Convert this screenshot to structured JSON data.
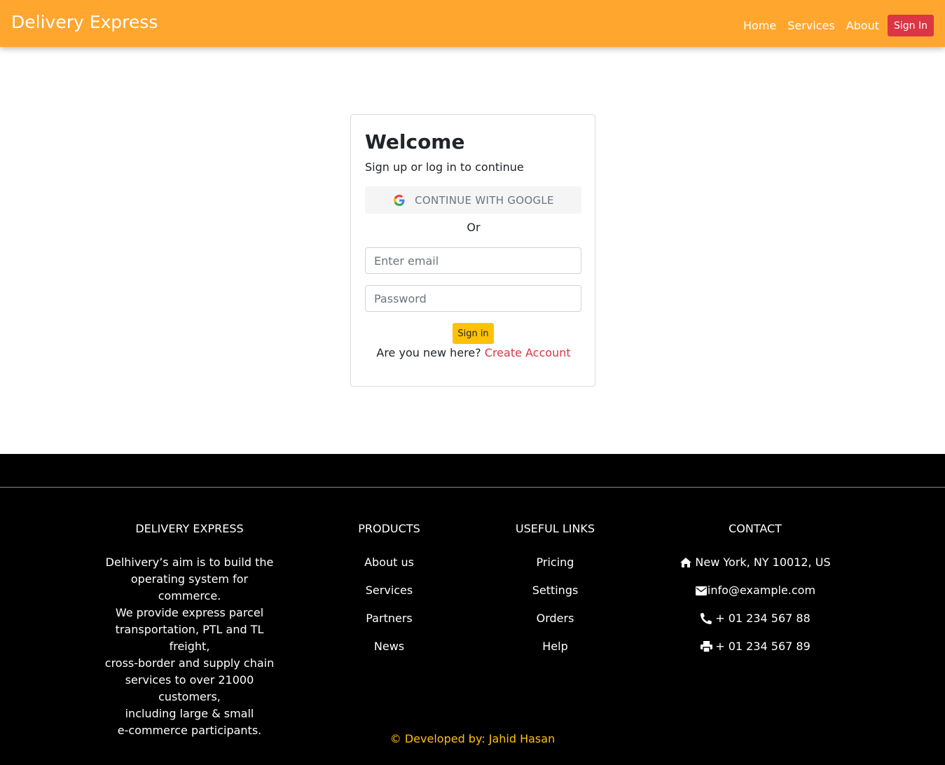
{
  "navbar": {
    "brand": "Delivery Express",
    "links": [
      "Home",
      "Services",
      "About"
    ],
    "signin_label": "Sign In",
    "bg_color": "#ffa62e"
  },
  "login_card": {
    "title": "Welcome",
    "subtitle": "Sign up or log in to continue",
    "google_label": "CONTINUE WITH GOOGLE",
    "or_label": "Or",
    "email_placeholder": "Enter email",
    "email_value": "",
    "password_placeholder": "Password",
    "password_value": "",
    "signin_label": "Sign in",
    "new_here_text": "Are you new here?",
    "create_account_label": "Create Account"
  },
  "footer": {
    "about": {
      "title": "DELIVERY EXPRESS",
      "lines": [
        "Delhivery’s aim is to build the",
        "operating system for commerce.",
        "We provide express parcel",
        "transportation, PTL and TL freight,",
        "cross-border and supply chain",
        "services to over 21000 customers,",
        "including large & small",
        "e-commerce participants."
      ]
    },
    "products": {
      "title": "PRODUCTS",
      "items": [
        "About us",
        "Services",
        "Partners",
        "News"
      ]
    },
    "useful_links": {
      "title": "USEFUL LINKS",
      "items": [
        "Pricing",
        "Settings",
        "Orders",
        "Help"
      ]
    },
    "contact": {
      "title": "CONTACT",
      "address": "New York, NY 10012, US",
      "email": "info@example.com",
      "phone": "+ 01 234 567 88",
      "fax": "+ 01 234 567 89"
    },
    "copyright": "© Developed by: Jahid Hasan"
  }
}
